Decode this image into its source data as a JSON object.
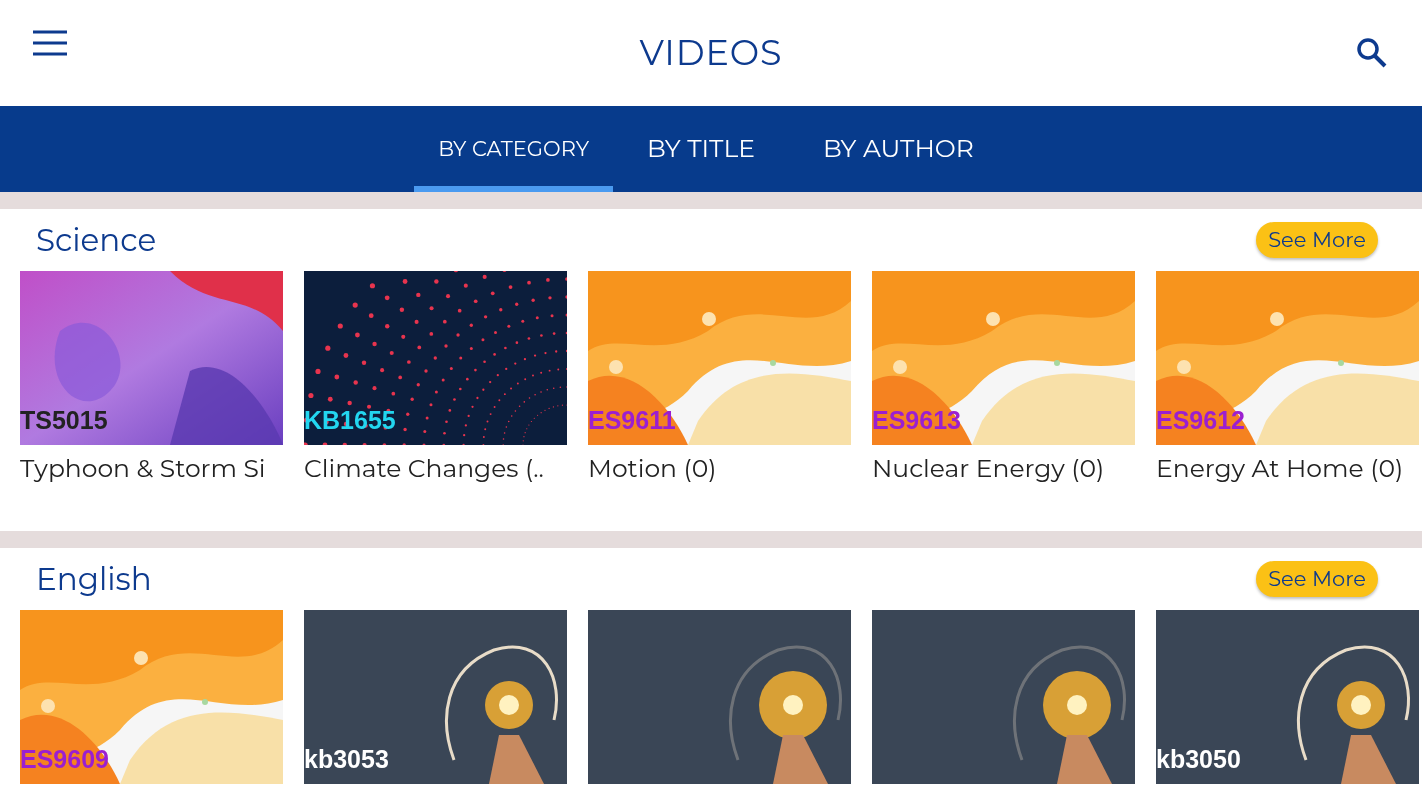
{
  "header": {
    "title": "VIDEOS"
  },
  "tabs": [
    {
      "label": "BY CATEGORY",
      "selected": true
    },
    {
      "label": "BY TITLE",
      "selected": false
    },
    {
      "label": "BY AUTHOR",
      "selected": false
    }
  ],
  "sections": [
    {
      "title": "Science",
      "button": "See More",
      "videos": [
        {
          "kind": "paint",
          "code": "TS5015",
          "title": "Typhoon & Storm Si"
        },
        {
          "kind": "dots",
          "code": "KB1655",
          "title": "Climate Changes (.."
        },
        {
          "kind": "waves",
          "code": "ES9611",
          "title": "Motion (0)"
        },
        {
          "kind": "waves",
          "code": "ES9613",
          "title": "Nuclear Energy  (0)"
        },
        {
          "kind": "waves",
          "code": "ES9612",
          "title": "Energy At Home (0)"
        }
      ]
    },
    {
      "title": "English",
      "button": "See More",
      "videos": [
        {
          "kind": "waves",
          "code": "ES9609"
        },
        {
          "kind": "bulb",
          "code": "kb3053"
        },
        {
          "kind": "bulb-blurred"
        },
        {
          "kind": "bulb-blurred"
        },
        {
          "kind": "bulb",
          "code": "kb3050"
        }
      ]
    }
  ]
}
